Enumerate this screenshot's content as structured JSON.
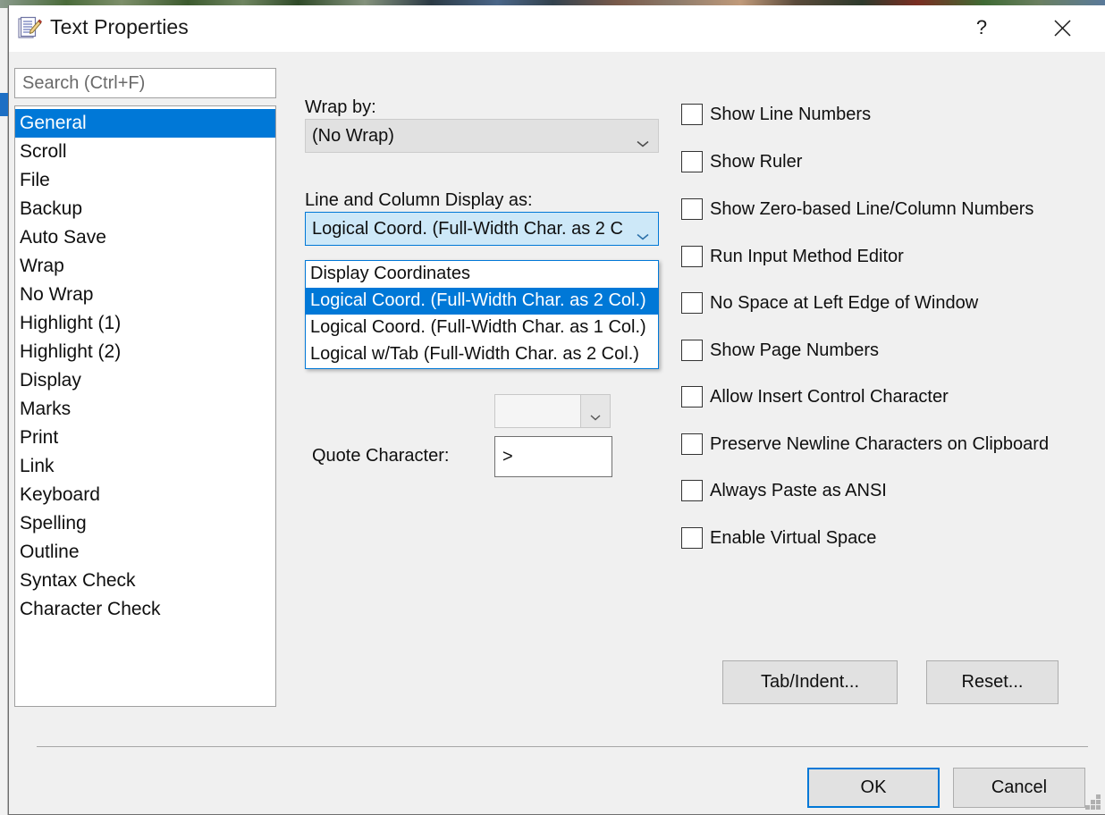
{
  "window": {
    "title": "Text Properties",
    "icon": "notepad-pencil-icon",
    "help_label": "?",
    "close_label": "✕",
    "accent_color": "#0078d7",
    "face_color": "#f0f0f0"
  },
  "search": {
    "placeholder": "Search (Ctrl+F)",
    "value": ""
  },
  "categories": {
    "selected": "General",
    "items": [
      {
        "label": "General"
      },
      {
        "label": "Scroll"
      },
      {
        "label": "File"
      },
      {
        "label": "Backup"
      },
      {
        "label": "Auto Save"
      },
      {
        "label": "Wrap"
      },
      {
        "label": "No Wrap"
      },
      {
        "label": "Highlight (1)"
      },
      {
        "label": "Highlight (2)"
      },
      {
        "label": "Display"
      },
      {
        "label": "Marks"
      },
      {
        "label": "Print"
      },
      {
        "label": "Link"
      },
      {
        "label": "Keyboard"
      },
      {
        "label": "Spelling"
      },
      {
        "label": "Outline"
      },
      {
        "label": "Syntax Check"
      },
      {
        "label": "Character Check"
      }
    ]
  },
  "fields": {
    "wrap_by": {
      "label": "Wrap by:",
      "value": "(No Wrap)"
    },
    "line_column_display": {
      "label": "Line and Column Display as:",
      "value": "Logical Coord. (Full-Width Char. as 2 C",
      "expanded": true,
      "options": [
        {
          "label": "Display Coordinates",
          "selected": false
        },
        {
          "label": "Logical Coord. (Full-Width Char. as 2 Col.)",
          "selected": true
        },
        {
          "label": "Logical Coord. (Full-Width Char. as 1 Col.)",
          "selected": false
        },
        {
          "label": "Logical w/Tab (Full-Width Char. as 2 Col.)",
          "selected": false
        }
      ]
    },
    "quote_character": {
      "label": "Quote Character:",
      "value": ">"
    }
  },
  "checkboxes": [
    {
      "label": "Show Line Numbers",
      "checked": false
    },
    {
      "label": "Show Ruler",
      "checked": false
    },
    {
      "label": "Show Zero-based Line/Column Numbers",
      "checked": false
    },
    {
      "label": "Run Input Method Editor",
      "checked": false
    },
    {
      "label": "No Space at Left Edge of Window",
      "checked": false
    },
    {
      "label": "Show Page Numbers",
      "checked": false
    },
    {
      "label": "Allow Insert Control Character",
      "checked": false
    },
    {
      "label": "Preserve Newline Characters on Clipboard",
      "checked": false
    },
    {
      "label": "Always Paste as ANSI",
      "checked": false
    },
    {
      "label": "Enable Virtual Space",
      "checked": false
    }
  ],
  "buttons": {
    "tab_indent": "Tab/Indent...",
    "reset": "Reset...",
    "ok": "OK",
    "cancel": "Cancel"
  }
}
